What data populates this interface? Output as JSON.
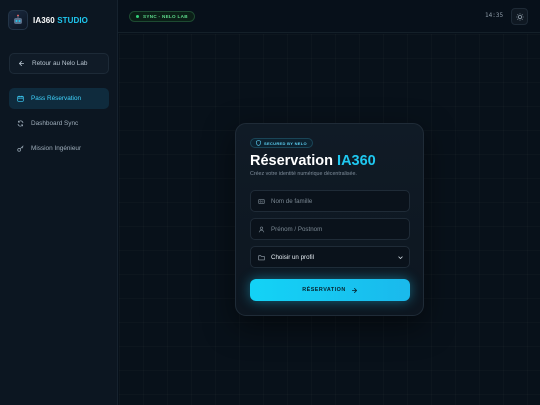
{
  "brand": {
    "name_a": "IA360",
    "name_b": "STUDIO",
    "logo_icon": "robot-icon"
  },
  "sidebar": {
    "back_label": "Retour au Nelo Lab",
    "items": [
      {
        "label": "Pass Réservation",
        "icon": "calendar-icon",
        "active": true
      },
      {
        "label": "Dashboard Sync",
        "icon": "sync-icon",
        "active": false
      },
      {
        "label": "Mission Ingénieur",
        "icon": "key-icon",
        "active": false
      }
    ]
  },
  "topbar": {
    "sync_badge": "SYNC - NELO LAB",
    "time": "14:35",
    "settings_icon": "sun-icon"
  },
  "card": {
    "badge": "SECURED BY NELO",
    "title_a": "Réservation",
    "title_b": "IA360",
    "subtitle": "Créez votre identité numérique décentralisée.",
    "last_name_placeholder": "Nom de famille",
    "first_name_placeholder": "Prénom / Postnom",
    "profile_select": "Choisir un profil",
    "submit_label": "RÉSERVATION"
  },
  "colors": {
    "accent": "#1fc8f0",
    "success": "#33d17a",
    "background": "#07101a"
  }
}
